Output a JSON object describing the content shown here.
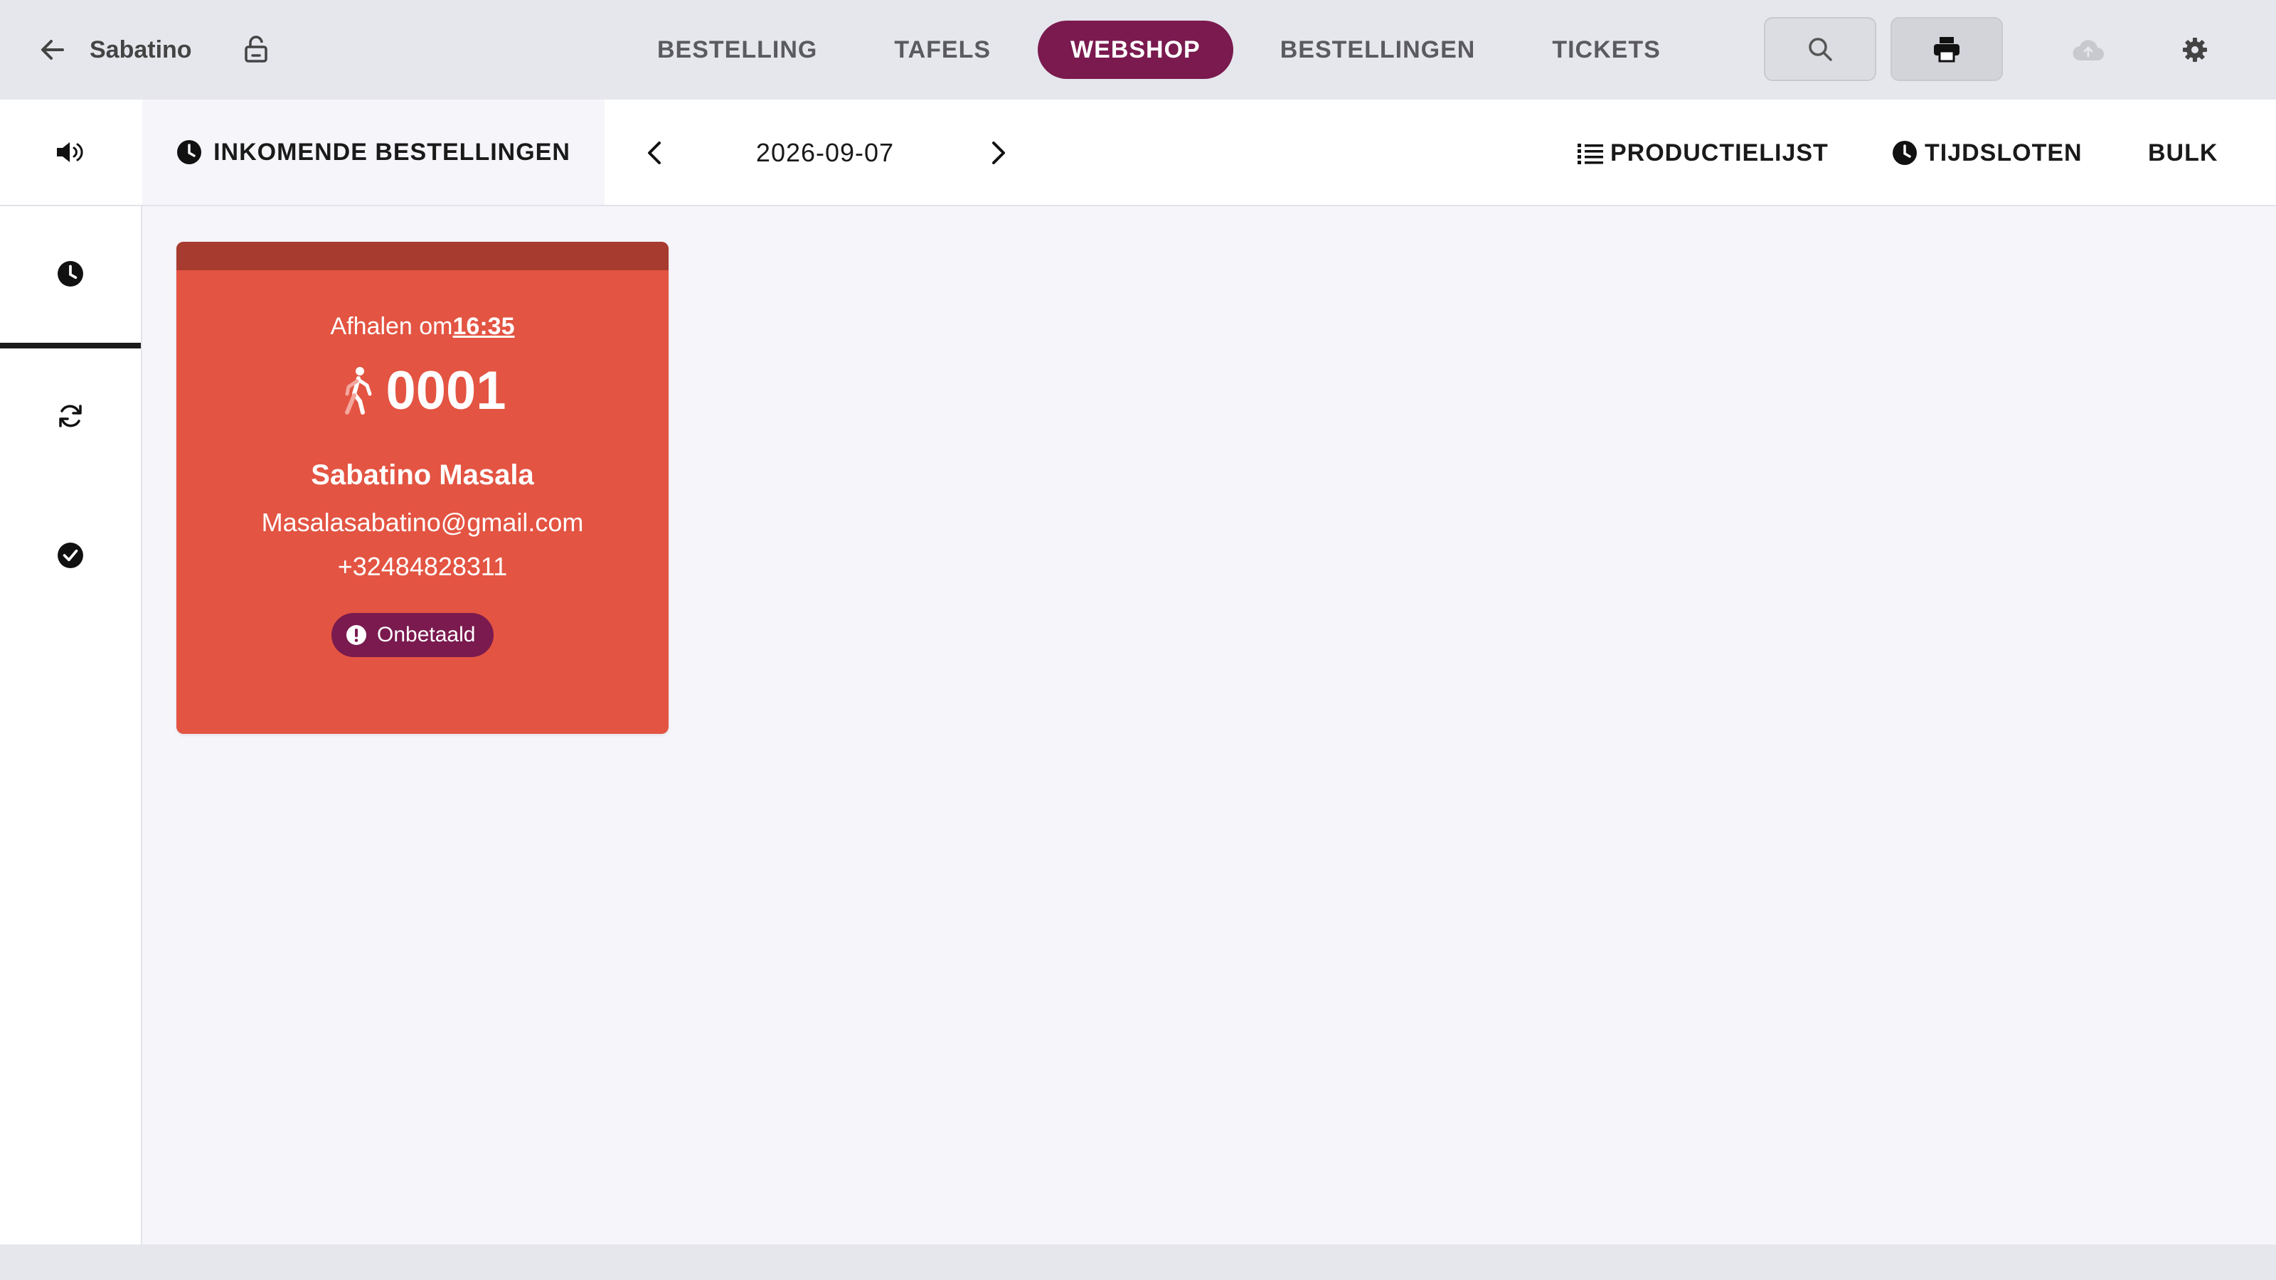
{
  "header": {
    "brand": "Sabatino",
    "tabs": [
      {
        "label": "BESTELLING"
      },
      {
        "label": "TAFELS"
      },
      {
        "label": "WEBSHOP",
        "active": true
      },
      {
        "label": "BESTELLINGEN"
      },
      {
        "label": "TICKETS"
      }
    ],
    "icons": [
      "arrow-left-icon",
      "lock-open-icon",
      "search-icon",
      "print-icon",
      "cloud-upload-icon",
      "gear-icon"
    ]
  },
  "subheader": {
    "incoming_label": "INKOMENDE BESTELLINGEN",
    "date": "2026-09-07",
    "productlist_label": "PRODUCTIELIJST",
    "timeslots_label": "TIJDSLOTEN",
    "bulk_label": "BULK"
  },
  "sidebar": {
    "items": [
      {
        "icon": "clock-icon",
        "active": true
      },
      {
        "icon": "refresh-icon"
      },
      {
        "icon": "check-circle-icon"
      }
    ]
  },
  "orders": [
    {
      "pickup_prefix": "Afhalen om",
      "pickup_time": "16:35",
      "number": "0001",
      "type_icon": "walking-person-icon",
      "customer_name": "Sabatino Masala",
      "email": "Masalasabatino@gmail.com",
      "phone": "+32484828311",
      "status": "Onbetaald",
      "color": "#e35442"
    }
  ],
  "colors": {
    "accent": "#7a1a4f",
    "card": "#e35442",
    "card_header": "#a83b2f"
  }
}
